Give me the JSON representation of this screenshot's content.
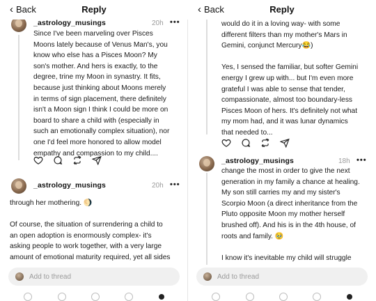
{
  "left": {
    "header": {
      "back_label": "Back",
      "title": "Reply"
    },
    "post1": {
      "username": "_astrology_musings",
      "time": "20h",
      "more": "•••",
      "lines": [
        "Since I've been marveling over Pisces",
        "Moons lately because of Venus Man's, you",
        "know who else has a Pisces Moon? My",
        "son's mother. And hers is exactly, to the",
        "degree, trine my Moon in synastry. It fits,",
        "because just thinking about Moons merely",
        "in terms of sign placement, there definitely",
        "isn't a Moon sign I think I could be more on",
        "board to share a child with (especially in",
        "such an emotionally complex situation), nor",
        "one I'd feel more honored to allow model",
        "empathy and compassion to my child...."
      ]
    },
    "post2": {
      "username": "_astrology_musings",
      "time": "20h",
      "more": "•••",
      "para1": "through her mothering. 🌖",
      "lines": [
        "Of course, the situation of surrendering a child to",
        "an open adoption is enormously complex- it's",
        "asking people to work together, with a very large",
        "amount of emotional maturity required, yet all sides"
      ]
    },
    "compose": {
      "placeholder": "Add to thread"
    }
  },
  "right": {
    "header": {
      "back_label": "Back",
      "title": "Reply"
    },
    "post1": {
      "lines_a": [
        "would do it in a loving way- with some",
        "different filters than my mother's Mars in",
        "Gemini, conjunct Mercury😂)"
      ],
      "lines_b": [
        "Yes, I sensed the familiar, but softer Gemini",
        "energy I grew up with... but I'm even more",
        "grateful I was able to sense that tender,",
        "compassionate, almost too boundary-less",
        "Pisces Moon of hers. It's definitely not what",
        "my mom had, and it was lunar dynamics",
        "that needed to..."
      ]
    },
    "post2": {
      "username": "_astrology_musings",
      "time": "18h",
      "more": "•••",
      "lines_a": [
        "change the most in order to give the next",
        "generation in my family a chance at healing.",
        "My son still carries my and my sister's",
        "Scorpio Moon (a direct inheritance from the",
        "Pluto opposite Moon my mother herself",
        "brushed off). And his is in the 4th house, of",
        "roots and family. 🥹"
      ],
      "lines_b": [
        "I know it's inevitable my child will struggle"
      ]
    },
    "compose": {
      "placeholder": "Add to thread"
    }
  }
}
